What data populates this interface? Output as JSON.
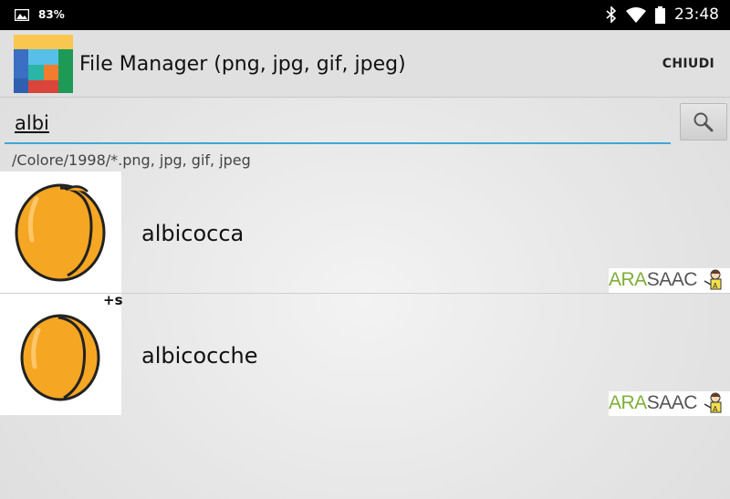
{
  "status_bar": {
    "battery_percent": "83%",
    "time": "23:48",
    "icons": [
      "image-icon",
      "bluetooth-icon",
      "wifi-icon",
      "battery-icon"
    ]
  },
  "action_bar": {
    "title": "File Manager (png, jpg, gif, jpeg)",
    "close_label": "CHIUDI"
  },
  "search": {
    "value": "albi",
    "icon": "search-icon"
  },
  "path": "/Colore/1998/*.png, jpg, gif, jpeg",
  "files": [
    {
      "name": "albicocca",
      "badge": "",
      "watermark": "ARASAAC"
    },
    {
      "name": "albicocche",
      "badge": "+s",
      "watermark": "ARASAAC"
    }
  ],
  "colors": {
    "accent_underline": "#3fa7d6",
    "fruit_orange": "#f5a623",
    "arasaac_green": "#7fae3a"
  }
}
